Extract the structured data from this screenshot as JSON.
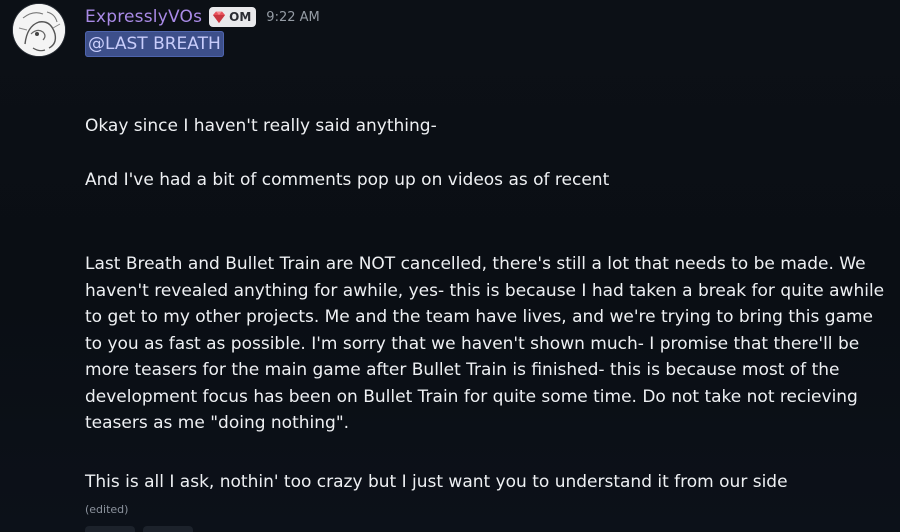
{
  "author": {
    "username": "ExpresslyVOs",
    "badge_label": "OM",
    "badge_icon": "gem-icon",
    "timestamp": "9:22 AM",
    "avatar": "avatar-sketch"
  },
  "mention": "@LAST BREATH",
  "paragraphs": [
    "Okay since I haven't really said anything-",
    "And I've had a bit of comments pop up on videos as of recent",
    "Last Breath and Bullet Train are NOT cancelled, there's still a lot that needs to be made. We haven't revealed anything for awhile, yes- this is because I had taken a break for quite awhile to get to my other projects. Me and the team have lives, and we're trying to bring this game to you as fast as possible. I'm sorry that we haven't shown much- I promise that there'll be more teasers for the main game after Bullet Train is finished- this is because most of the development focus has been on Bullet Train for quite some time. Do not take not recieving teasers as me \"doing nothing\".",
    "This is all I ask, nothin' too crazy but I just want you to understand it from our side"
  ],
  "edited_label": "(edited)",
  "colors": {
    "username": "#a98ae6",
    "mention_bg": "#3d4f8a",
    "mention_text": "#c9cdfb",
    "badge_bg": "#e9e9ec",
    "gem": "#e8505b"
  }
}
